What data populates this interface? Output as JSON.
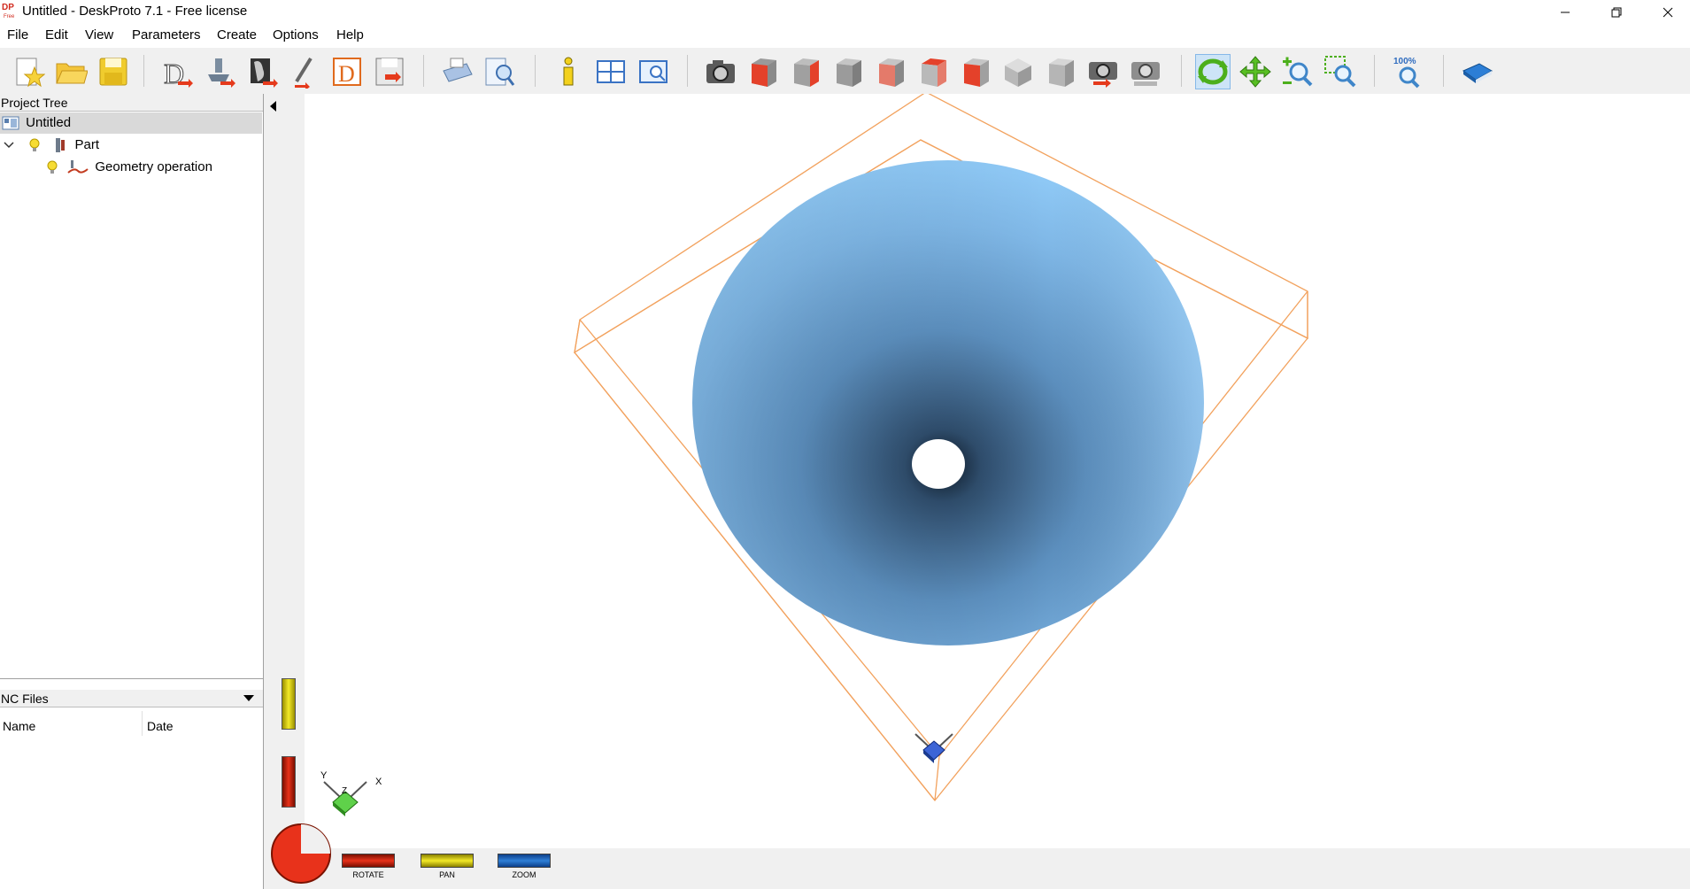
{
  "window": {
    "title": "Untitled - DeskProto 7.1 - Free license",
    "logo_text": "DP"
  },
  "menu": [
    "File",
    "Edit",
    "View",
    "Parameters",
    "Create",
    "Options",
    "Help"
  ],
  "toolbar": {
    "groups": [
      [
        "new-project-icon",
        "open-project-icon",
        "save-project-icon"
      ],
      [
        "load-geometry-icon",
        "part-parameters-icon",
        "operation-parameters-icon",
        "cutter-parameters-icon",
        "create-nc-icon",
        "save-nc-icon"
      ],
      [
        "print-icon",
        "print-preview-icon"
      ],
      [
        "info-icon",
        "window-layout-icon",
        "view-window-icon"
      ],
      [
        "camera-icon",
        "view-front-icon",
        "view-back-icon",
        "view-left-icon",
        "view-right-icon",
        "view-top-icon",
        "view-bottom-icon",
        "view-iso-icon",
        "view-iso-2-icon",
        "camera-restore-icon",
        "camera-store-icon"
      ],
      [
        "rotate-mode-icon",
        "pan-mode-icon",
        "zoom-mode-icon",
        "zoom-window-icon"
      ],
      [
        "zoom-100-icon"
      ],
      [
        "help-book-icon"
      ]
    ],
    "zoom_100_label": "100%"
  },
  "project_tree": {
    "header": "Project Tree",
    "items": [
      {
        "label": "Untitled",
        "level": 0
      },
      {
        "label": "Part",
        "level": 1
      },
      {
        "label": "Geometry operation",
        "level": 2
      }
    ]
  },
  "nc_files": {
    "header": "NC Files",
    "columns": [
      "Name",
      "Date"
    ]
  },
  "viewport_controls": {
    "rotate_label": "ROTATE",
    "pan_label": "PAN",
    "zoom_label": "ZOOM"
  },
  "axes": {
    "x": "X",
    "y": "Y",
    "z": "Z"
  },
  "colors": {
    "model_light": "#8cc6f3",
    "model_dark": "#3a5f82",
    "bounding_box": "#f2a25e",
    "rotate": "#e8321b",
    "pan": "#e6d81c",
    "zoom": "#2f7fd6",
    "toolbar_bg": "#f0f0f0",
    "selection": "#cde4f7"
  }
}
